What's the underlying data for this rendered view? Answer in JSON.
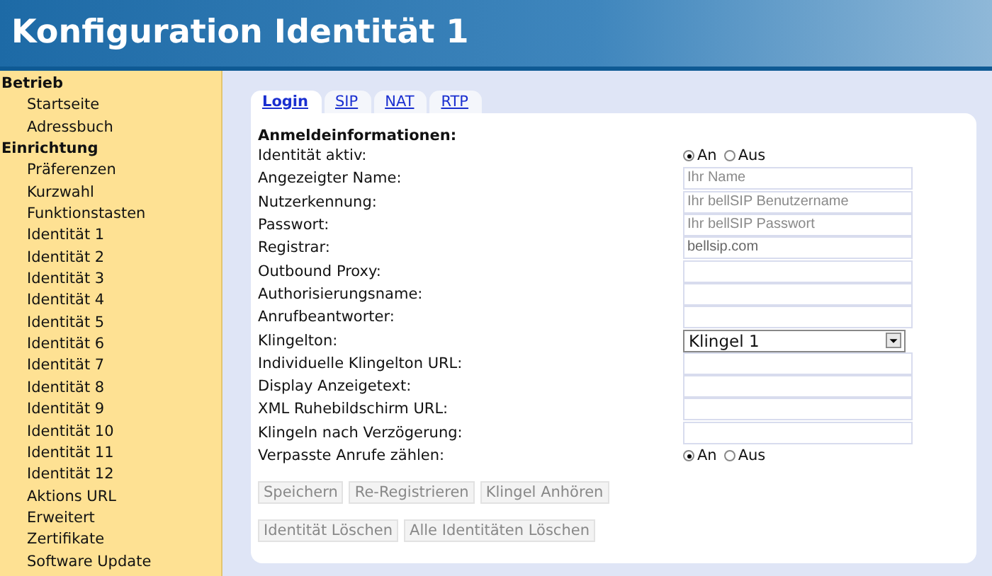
{
  "header": {
    "title": "Konfiguration Identität 1"
  },
  "sidebar": {
    "groups": [
      {
        "label": "Betrieb",
        "items": [
          "Startseite",
          "Adressbuch"
        ]
      },
      {
        "label": "Einrichtung",
        "items": [
          "Präferenzen",
          "Kurzwahl",
          "Funktionstasten",
          "Identität 1",
          "Identität 2",
          "Identität 3",
          "Identität 4",
          "Identität 5",
          "Identität 6",
          "Identität 7",
          "Identität 8",
          "Identität 9",
          "Identität 10",
          "Identität 11",
          "Identität 12",
          "Aktions URL",
          "Erweitert",
          "Zertifikate",
          "Software Update"
        ]
      }
    ]
  },
  "tabs": [
    {
      "label": "Login",
      "selected": true
    },
    {
      "label": "SIP",
      "selected": false
    },
    {
      "label": "NAT",
      "selected": false
    },
    {
      "label": "RTP",
      "selected": false
    }
  ],
  "section_title": "Anmeldeinformationen:",
  "fields": [
    {
      "kind": "radio",
      "label": "Identität aktiv:",
      "options": [
        {
          "label": "An",
          "selected": true
        },
        {
          "label": "Aus",
          "selected": false
        }
      ]
    },
    {
      "kind": "text",
      "label": "Angezeigter Name:",
      "placeholder": "Ihr Name"
    },
    {
      "kind": "text",
      "label": "Nutzerkennung:",
      "placeholder": "Ihr bellSIP Benutzername"
    },
    {
      "kind": "text",
      "label": "Passwort:",
      "placeholder": "Ihr bellSIP Passwort"
    },
    {
      "kind": "text",
      "label": "Registrar:",
      "value": "bellsip.com"
    },
    {
      "kind": "text",
      "label": "Outbound Proxy:"
    },
    {
      "kind": "text",
      "label": "Authorisierungsname:"
    },
    {
      "kind": "text",
      "label": "Anrufbeantworter:"
    },
    {
      "kind": "select",
      "label": "Klingelton:",
      "value": "Klingel 1"
    },
    {
      "kind": "text",
      "label": "Individuelle Klingelton URL:"
    },
    {
      "kind": "text",
      "label": "Display Anzeigetext:"
    },
    {
      "kind": "text",
      "label": "XML Ruhebildschirm URL:"
    },
    {
      "kind": "text",
      "label": "Klingeln nach Verzögerung:"
    },
    {
      "kind": "radio",
      "label": "Verpasste Anrufe zählen:",
      "options": [
        {
          "label": "An",
          "selected": true
        },
        {
          "label": "Aus",
          "selected": false
        }
      ]
    }
  ],
  "button_rows": [
    [
      {
        "label": "Speichern",
        "disabled": true
      },
      {
        "label": "Re-Registrieren",
        "disabled": true
      },
      {
        "label": "Klingel Anhören",
        "disabled": true
      }
    ],
    [
      {
        "label": "Identität Löschen",
        "disabled": true
      },
      {
        "label": "Alle Identitäten Löschen",
        "disabled": true
      }
    ]
  ]
}
